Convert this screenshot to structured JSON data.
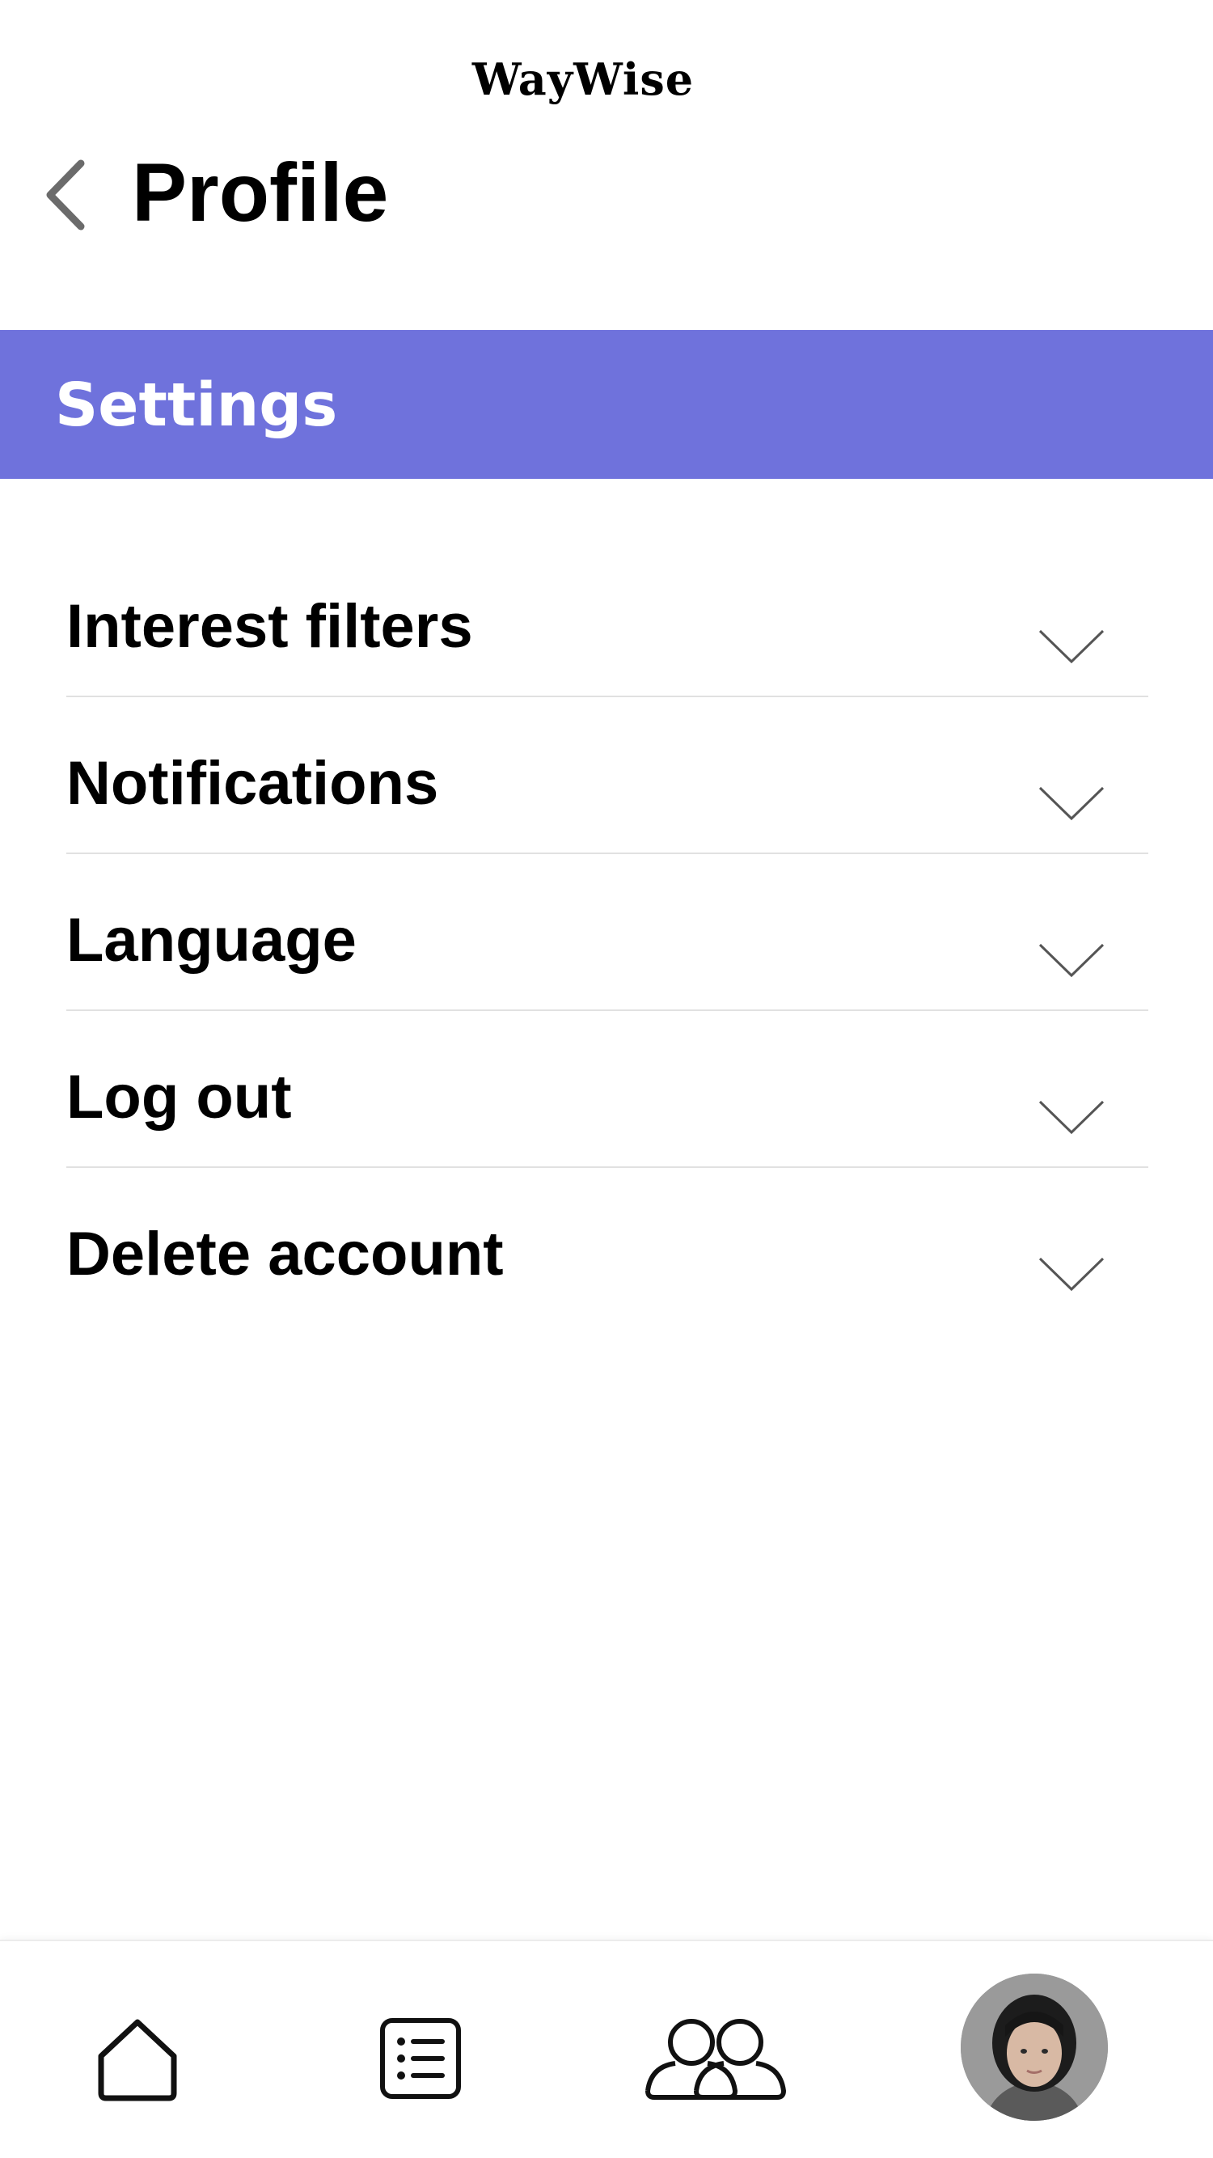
{
  "header": {
    "app_title": "WayWise",
    "back_icon": "chevron-left-icon",
    "page_title": "Profile"
  },
  "settings": {
    "title": "Settings",
    "accent_color": "#6f72dc",
    "items": [
      {
        "label": "Interest filters",
        "icon": "chevron-down-icon"
      },
      {
        "label": "Notifications",
        "icon": "chevron-down-icon"
      },
      {
        "label": "Language",
        "icon": "chevron-down-icon"
      },
      {
        "label": "Log out",
        "icon": "chevron-down-icon"
      },
      {
        "label": "Delete account",
        "icon": "chevron-down-icon"
      }
    ]
  },
  "bottom_nav": {
    "items": [
      {
        "icon": "home-icon"
      },
      {
        "icon": "list-icon"
      },
      {
        "icon": "community-icon"
      },
      {
        "icon": "profile-avatar"
      }
    ]
  }
}
